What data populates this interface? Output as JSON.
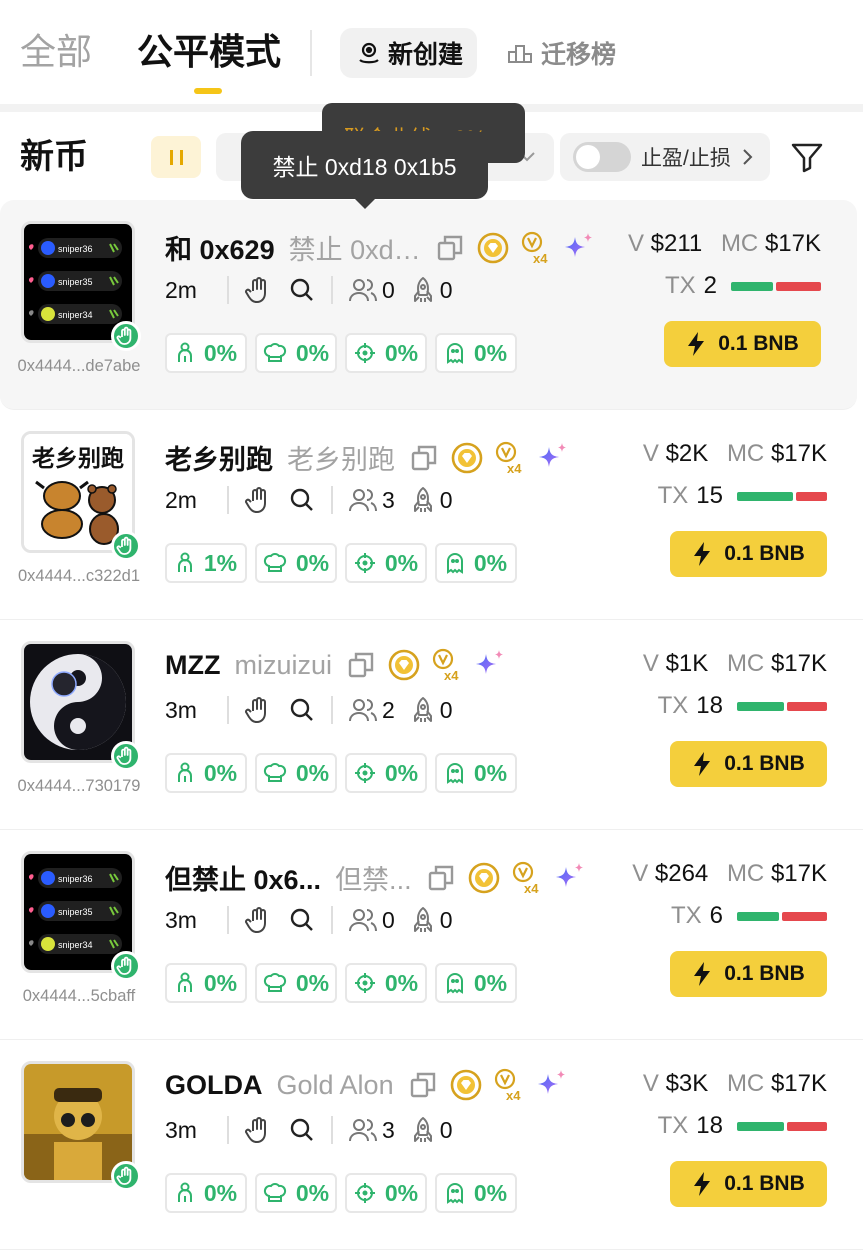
{
  "tabs": {
    "all": "全部",
    "fair": "公平模式",
    "new": "新创建",
    "migrate": "迁移榜"
  },
  "filter": {
    "title": "新币",
    "tp_sl": "止盈/止损"
  },
  "tooltip": {
    "back": "联合曲线：0%",
    "front": "禁止 0xd18 0x1b5"
  },
  "colors": {
    "accent": "#f5c518",
    "green": "#2fb46d",
    "red": "#e5484d",
    "buy": "#f4cf3c"
  },
  "rows": [
    {
      "symbol": "和 0x629",
      "full_name": "禁止 0xd…",
      "address": "0x4444...de7abe",
      "age": "2m",
      "holders": "0",
      "rockets": "0",
      "pills": [
        "0%",
        "0%",
        "0%",
        "0%"
      ],
      "v_label": "V",
      "v": "$211",
      "mc_label": "MC",
      "mc": "$17K",
      "tx_label": "TX",
      "tx": "2",
      "buy_ratio": 0.5,
      "buy": "0.1 BNB",
      "avatar": "sniper-list",
      "badge": "x4"
    },
    {
      "symbol": "老乡别跑",
      "full_name": "老乡别跑",
      "address": "0x4444...c322d1",
      "age": "2m",
      "holders": "3",
      "rockets": "0",
      "pills": [
        "1%",
        "0%",
        "0%",
        "0%"
      ],
      "v_label": "V",
      "v": "$2K",
      "mc_label": "MC",
      "mc": "$17K",
      "tx_label": "TX",
      "tx": "15",
      "buy_ratio": 0.65,
      "buy": "0.1 BNB",
      "avatar": "meme-ox-bear",
      "avatar_text": "老乡别跑",
      "badge": "x4"
    },
    {
      "symbol": "MZZ",
      "full_name": "mizuizui",
      "address": "0x4444...730179",
      "age": "3m",
      "holders": "2",
      "rockets": "0",
      "pills": [
        "0%",
        "0%",
        "0%",
        "0%"
      ],
      "v_label": "V",
      "v": "$1K",
      "mc_label": "MC",
      "mc": "$17K",
      "tx_label": "TX",
      "tx": "18",
      "buy_ratio": 0.55,
      "buy": "0.1 BNB",
      "avatar": "yin-yang",
      "badge": "x4"
    },
    {
      "symbol": "但禁止 0x6...",
      "full_name": "但禁...",
      "address": "0x4444...5cbaff",
      "age": "3m",
      "holders": "0",
      "rockets": "0",
      "pills": [
        "0%",
        "0%",
        "0%",
        "0%"
      ],
      "v_label": "V",
      "v": "$264",
      "mc_label": "MC",
      "mc": "$17K",
      "tx_label": "TX",
      "tx": "6",
      "buy_ratio": 0.5,
      "buy": "0.1 BNB",
      "avatar": "sniper-list",
      "badge": "x4"
    },
    {
      "symbol": "GOLDA",
      "full_name": "Gold Alon",
      "address": "",
      "age": "3m",
      "holders": "3",
      "rockets": "0",
      "pills": [
        "0%",
        "0%",
        "0%",
        "0%"
      ],
      "v_label": "V",
      "v": "$3K",
      "mc_label": "MC",
      "mc": "$17K",
      "tx_label": "TX",
      "tx": "18",
      "buy_ratio": 0.55,
      "buy": "0.1 BNB",
      "avatar": "gold-figure",
      "badge": "x4"
    }
  ]
}
